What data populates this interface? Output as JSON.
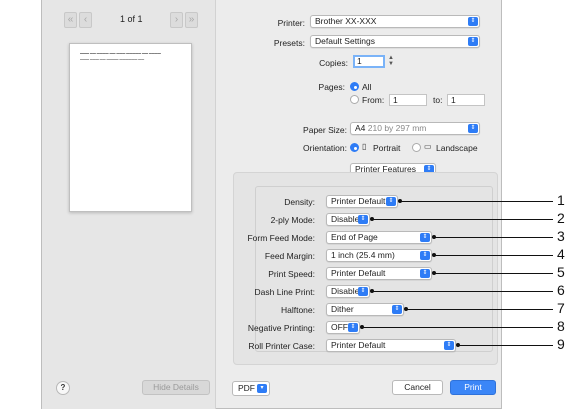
{
  "preview": {
    "first_page_label": "«",
    "prev_page_label": "‹",
    "page_indicator": "1 of 1",
    "next_page_label": "›",
    "last_page_label": "»",
    "help_label": "?",
    "hide_details_label": "Hide Details"
  },
  "printer": {
    "label": "Printer:",
    "value": "Brother XX-XXX"
  },
  "presets": {
    "label": "Presets:",
    "value": "Default Settings"
  },
  "copies": {
    "label": "Copies:",
    "value": "1"
  },
  "pages": {
    "label": "Pages:",
    "all_label": "All",
    "from_label": "From:",
    "from_value": "1",
    "to_label": "to:",
    "to_value": "1"
  },
  "paper_size": {
    "label": "Paper Size:",
    "value": "A4",
    "detail": "210 by 297 mm"
  },
  "orientation": {
    "label": "Orientation:",
    "portrait_label": "Portrait",
    "landscape_label": "Landscape"
  },
  "section": {
    "value": "Printer Features"
  },
  "features": [
    {
      "label": "Density:",
      "value": "Printer Default",
      "callout": "1"
    },
    {
      "label": "2-ply Mode:",
      "value": "Disable",
      "callout": "2"
    },
    {
      "label": "Form Feed Mode:",
      "value": "End of Page",
      "callout": "3"
    },
    {
      "label": "Feed Margin:",
      "value": "1 inch (25.4 mm)",
      "callout": "4"
    },
    {
      "label": "Print Speed:",
      "value": "Printer Default",
      "callout": "5"
    },
    {
      "label": "Dash Line Print:",
      "value": "Disable",
      "callout": "6"
    },
    {
      "label": "Halftone:",
      "value": "Dither",
      "callout": "7"
    },
    {
      "label": "Negative Printing:",
      "value": "OFF",
      "callout": "8"
    },
    {
      "label": "Roll Printer Case:",
      "value": "Printer Default",
      "callout": "9"
    }
  ],
  "footer": {
    "pdf_label": "PDF",
    "cancel_label": "Cancel",
    "print_label": "Print"
  },
  "colors": {
    "accent": "#2e7cf6",
    "print_button": "#3b86f7"
  }
}
